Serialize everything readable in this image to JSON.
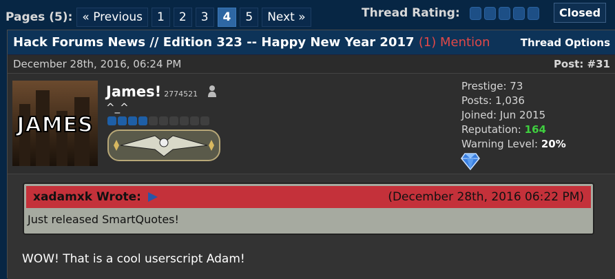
{
  "pagination": {
    "label": "Pages (5):",
    "previous": "« Previous",
    "pages": [
      "1",
      "2",
      "3",
      "4",
      "5"
    ],
    "current": "4",
    "next": "Next »"
  },
  "rating": {
    "label": "Thread Rating:",
    "stars": 5
  },
  "closed_label": "Closed",
  "thread": {
    "title": "Hack Forums News // Edition 323 -- Happy New Year 2017",
    "mention": "(1) Mention",
    "options": "Thread Options"
  },
  "post": {
    "date": "December 28th, 2016, 06:24 PM",
    "number": "Post: #31",
    "author": {
      "name": "James!",
      "uid": "2774521",
      "usertitle": "^_^",
      "avatar_text": "JAMES",
      "rank_stars_on": 4,
      "rank_stars_total": 11
    },
    "stats": {
      "prestige": "Prestige: 73",
      "posts": "Posts: 1,036",
      "joined": "Joined: Jun 2015",
      "reputation_label": "Reputation:",
      "reputation_value": "164",
      "warning_label": "Warning Level:",
      "warning_value": "20%"
    },
    "quote": {
      "who": "xadamxk Wrote:",
      "date": "(December 28th, 2016 06:22 PM)",
      "text": "Just released SmartQuotes!"
    },
    "message": "WOW! That is a cool userscript Adam!"
  },
  "colors": {
    "accent": "#2e67a3",
    "mention": "#e04848",
    "quote_header": "#c4313a",
    "reputation": "#3fd03f"
  }
}
